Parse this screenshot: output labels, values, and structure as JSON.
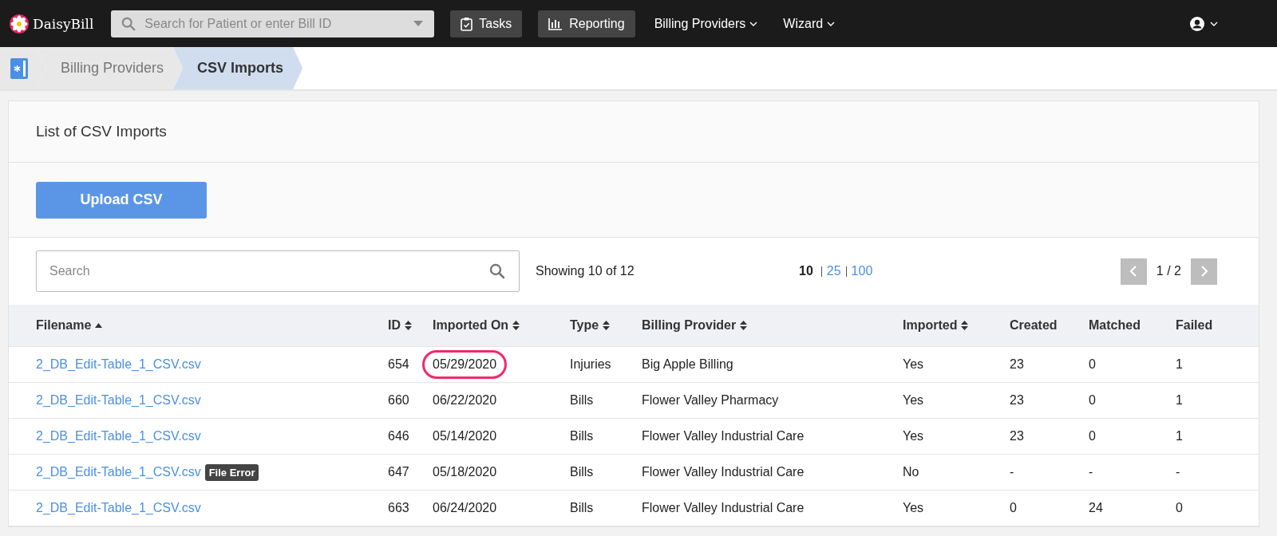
{
  "navbar": {
    "brand": "DaisyBill",
    "search": {
      "placeholder": "Search for Patient or enter Bill ID"
    },
    "buttons": [
      {
        "kind": "tasks",
        "label": "Tasks"
      },
      {
        "kind": "reporting",
        "label": "Reporting"
      }
    ],
    "menus": [
      "Billing Providers",
      "Wizard"
    ]
  },
  "breadcrumb": [
    {
      "label": "Billing Providers",
      "selected": false
    },
    {
      "label": "CSV Imports",
      "selected": true
    }
  ],
  "panel": {
    "title": "List of CSV Imports",
    "upload_button": "Upload CSV",
    "search": {
      "placeholder": "Search"
    },
    "showing": "Showing 10 of 12",
    "page_sizes": [
      {
        "label": "10",
        "selected": true
      },
      {
        "label": "25",
        "selected": false
      },
      {
        "label": "100",
        "selected": false
      }
    ],
    "pagination": {
      "page": "1 / 2"
    }
  },
  "table": {
    "columns": [
      {
        "label": "Filename",
        "kind": "sorted"
      },
      {
        "label": "ID",
        "kind": "sortable"
      },
      {
        "label": "Imported On",
        "kind": "sortable"
      },
      {
        "label": "Type",
        "kind": "sortable"
      },
      {
        "label": "Billing Provider",
        "kind": "sortable"
      },
      {
        "label": "Imported",
        "kind": "sortable"
      },
      {
        "label": "Created",
        "kind": "plain"
      },
      {
        "label": "Matched",
        "kind": "plain"
      },
      {
        "label": "Failed",
        "kind": "plain"
      }
    ],
    "rows": [
      {
        "filename": "2_DB_Edit-Table_1_CSV.csv",
        "id": "654",
        "imported_on": "05/29/2020",
        "circled": true,
        "type": "Injuries",
        "provider": "Big Apple Billing",
        "imported": "Yes",
        "created": "23",
        "matched": "0",
        "failed": "1"
      },
      {
        "filename": "2_DB_Edit-Table_1_CSV.csv",
        "id": "660",
        "imported_on": "06/22/2020",
        "circled": false,
        "type": "Bills",
        "provider": "Flower Valley Pharmacy",
        "imported": "Yes",
        "created": "23",
        "matched": "0",
        "failed": "1"
      },
      {
        "filename": "2_DB_Edit-Table_1_CSV.csv",
        "id": "646",
        "imported_on": "05/14/2020",
        "circled": false,
        "type": "Bills",
        "provider": "Flower Valley Industrial Care",
        "imported": "Yes",
        "created": "23",
        "matched": "0",
        "failed": "1"
      },
      {
        "filename": "2_DB_Edit-Table_1_CSV.csv",
        "badge": "File Error",
        "id": "647",
        "imported_on": "05/18/2020",
        "circled": false,
        "type": "Bills",
        "provider": "Flower Valley Industrial Care",
        "imported": "No",
        "created": "-",
        "matched": "-",
        "failed": "-"
      },
      {
        "filename": "2_DB_Edit-Table_1_CSV.csv",
        "id": "663",
        "imported_on": "06/24/2020",
        "circled": false,
        "type": "Bills",
        "provider": "Flower Valley Industrial Care",
        "imported": "Yes",
        "created": "0",
        "matched": "24",
        "failed": "0"
      }
    ]
  }
}
